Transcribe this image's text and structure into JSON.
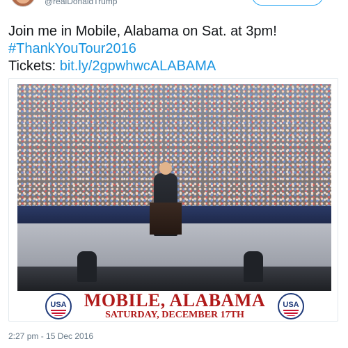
{
  "tweet": {
    "handle": "@realDonaldTrump",
    "text_line1": "Join me in Mobile, Alabama on Sat. at 3pm!",
    "hashtag": "#ThankYouTour2016",
    "tickets_label": "Tickets: ",
    "tickets_link": "bit.ly/2gpwhwcALABAMA",
    "timestamp": "2:27 pm - 15 Dec 2016"
  },
  "media": {
    "event_title": "MOBILE, ALABAMA",
    "event_date": "SATURDAY, DECEMBER 17TH",
    "seal_text": "USA"
  },
  "colors": {
    "link": "#1b95e0",
    "event_red": "#b01a1a",
    "seal_blue": "#1f3a7a"
  }
}
